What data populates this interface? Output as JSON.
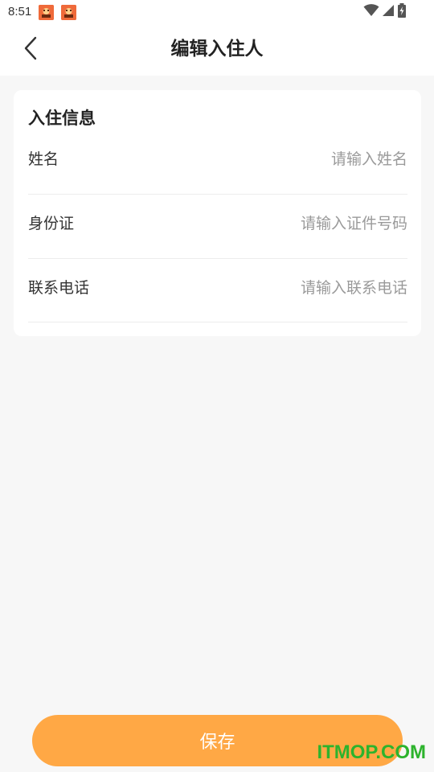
{
  "status_bar": {
    "time": "8:51",
    "notification_icons": [
      "app-notification-icon",
      "app-notification-icon"
    ],
    "system_icons": [
      "wifi-icon",
      "cell-signal-icon",
      "battery-charging-icon"
    ]
  },
  "nav": {
    "back_icon": "chevron-left-icon",
    "title": "编辑入住人"
  },
  "card": {
    "title": "入住信息",
    "fields": [
      {
        "label": "姓名",
        "value": "",
        "placeholder": "请输入姓名"
      },
      {
        "label": "身份证",
        "value": "",
        "placeholder": "请输入证件号码"
      },
      {
        "label": "联系电话",
        "value": "",
        "placeholder": "请输入联系电话"
      }
    ]
  },
  "actions": {
    "save_label": "保存"
  },
  "watermark": {
    "text": "ITMOP.COM"
  },
  "colors": {
    "accent": "#ffa845",
    "watermark": "#2db32d",
    "background": "#f7f7f7",
    "notification_icon": "#ef6a3a"
  }
}
